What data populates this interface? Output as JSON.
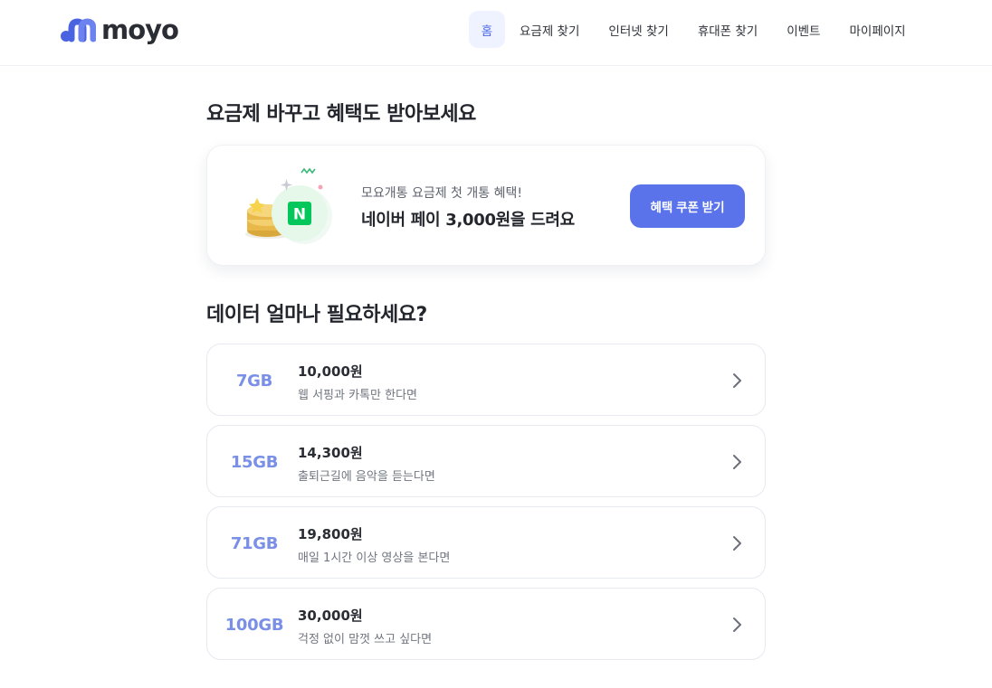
{
  "header": {
    "logo_text": "moyo",
    "nav": [
      {
        "label": "홈",
        "active": true
      },
      {
        "label": "요금제 찾기",
        "active": false
      },
      {
        "label": "인터넷 찾기",
        "active": false
      },
      {
        "label": "휴대폰 찾기",
        "active": false
      },
      {
        "label": "이벤트",
        "active": false
      },
      {
        "label": "마이페이지",
        "active": false
      }
    ]
  },
  "promo_section": {
    "title": "요금제 바꾸고 혜택도 받아보세요",
    "subtitle": "모요개통 요금제 첫 개통 혜택!",
    "headline": "네이버 페이 3,000원을 드려요",
    "button_label": "혜택 쿠폰 받기",
    "art_badge": "N",
    "art_icon": "naver-pay-coins-icon"
  },
  "plan_section": {
    "title": "데이터 얼마나 필요하세요?",
    "plans": [
      {
        "data": "7GB",
        "price": "10,000원",
        "desc": "웹 서핑과 카톡만 한다면"
      },
      {
        "data": "15GB",
        "price": "14,300원",
        "desc": "출퇴근길에 음악을 듣는다면"
      },
      {
        "data": "71GB",
        "price": "19,800원",
        "desc": "매일 1시간 이상 영상을 본다면"
      },
      {
        "data": "100GB",
        "price": "30,000원",
        "desc": "걱정 없이 맘껏 쓰고 싶다면"
      }
    ]
  },
  "colors": {
    "brand": "#5a73ea",
    "gb_text": "#7a8fe6",
    "nav_active_bg": "#eef3ff",
    "naver_green": "#03c75a"
  }
}
